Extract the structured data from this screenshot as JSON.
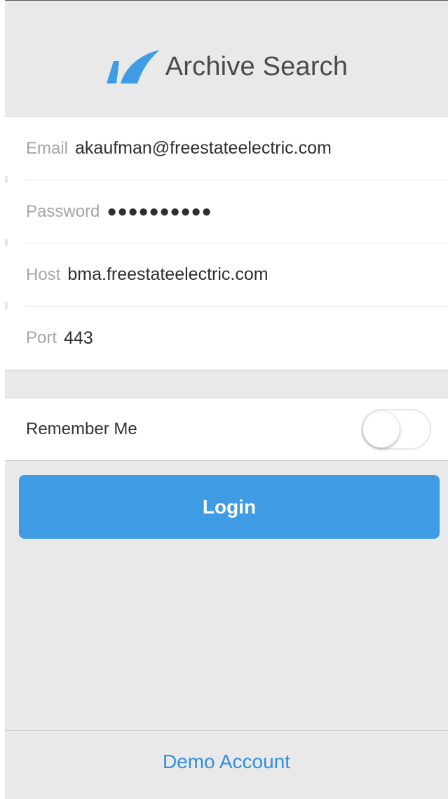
{
  "app": {
    "title": "Archive Search",
    "logo_icon": "barracuda-fin-icon",
    "brand_color": "#3f9ce4"
  },
  "form": {
    "email": {
      "label": "Email",
      "value": "akaufman@freestateelectric.com"
    },
    "password": {
      "label": "Password",
      "value": "●●●●●●●●●●"
    },
    "host": {
      "label": "Host",
      "value": "bma.freestateelectric.com"
    },
    "port": {
      "label": "Port",
      "value": "443"
    }
  },
  "remember_me": {
    "label": "Remember Me",
    "enabled": false
  },
  "login_button": {
    "label": "Login"
  },
  "demo_account": {
    "label": "Demo Account",
    "color": "#2f8fdf"
  }
}
